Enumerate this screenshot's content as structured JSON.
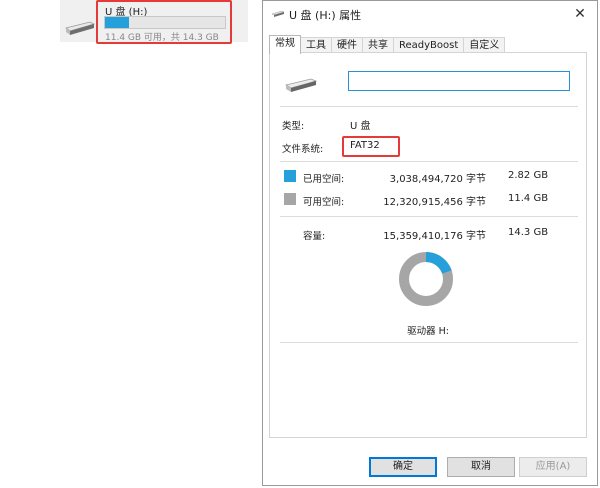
{
  "explorer": {
    "drive_name": "U 盘 (H:)",
    "usage_fraction": 0.2,
    "summary": "11.4 GB 可用，共 14.3 GB"
  },
  "dialog": {
    "title": "U 盘 (H:) 属性",
    "close_glyph": "✕",
    "tabs": [
      {
        "label": "常规",
        "active": true
      },
      {
        "label": "工具"
      },
      {
        "label": "硬件"
      },
      {
        "label": "共享"
      },
      {
        "label": "ReadyBoost"
      },
      {
        "label": "自定义"
      }
    ],
    "volume_label_value": "",
    "type_label": "类型:",
    "type_value": "U 盘",
    "fs_label": "文件系统:",
    "fs_value": "FAT32",
    "used": {
      "label": "已用空间:",
      "bytes": "3,038,494,720 字节",
      "size": "2.82 GB",
      "color": "#26a0da"
    },
    "free": {
      "label": "可用空间:",
      "bytes": "12,320,915,456 字节",
      "size": "11.4 GB",
      "color": "#a6a6a6"
    },
    "capacity": {
      "label": "容量:",
      "bytes": "15,359,410,176 字节",
      "size": "14.3 GB"
    },
    "drive_letter": "驱动器 H:",
    "used_fraction": 0.198,
    "buttons": {
      "ok": "确定",
      "cancel": "取消",
      "apply": "应用(A)"
    }
  },
  "colors": {
    "highlight": "#e53a3a",
    "accent": "#26a0da"
  }
}
